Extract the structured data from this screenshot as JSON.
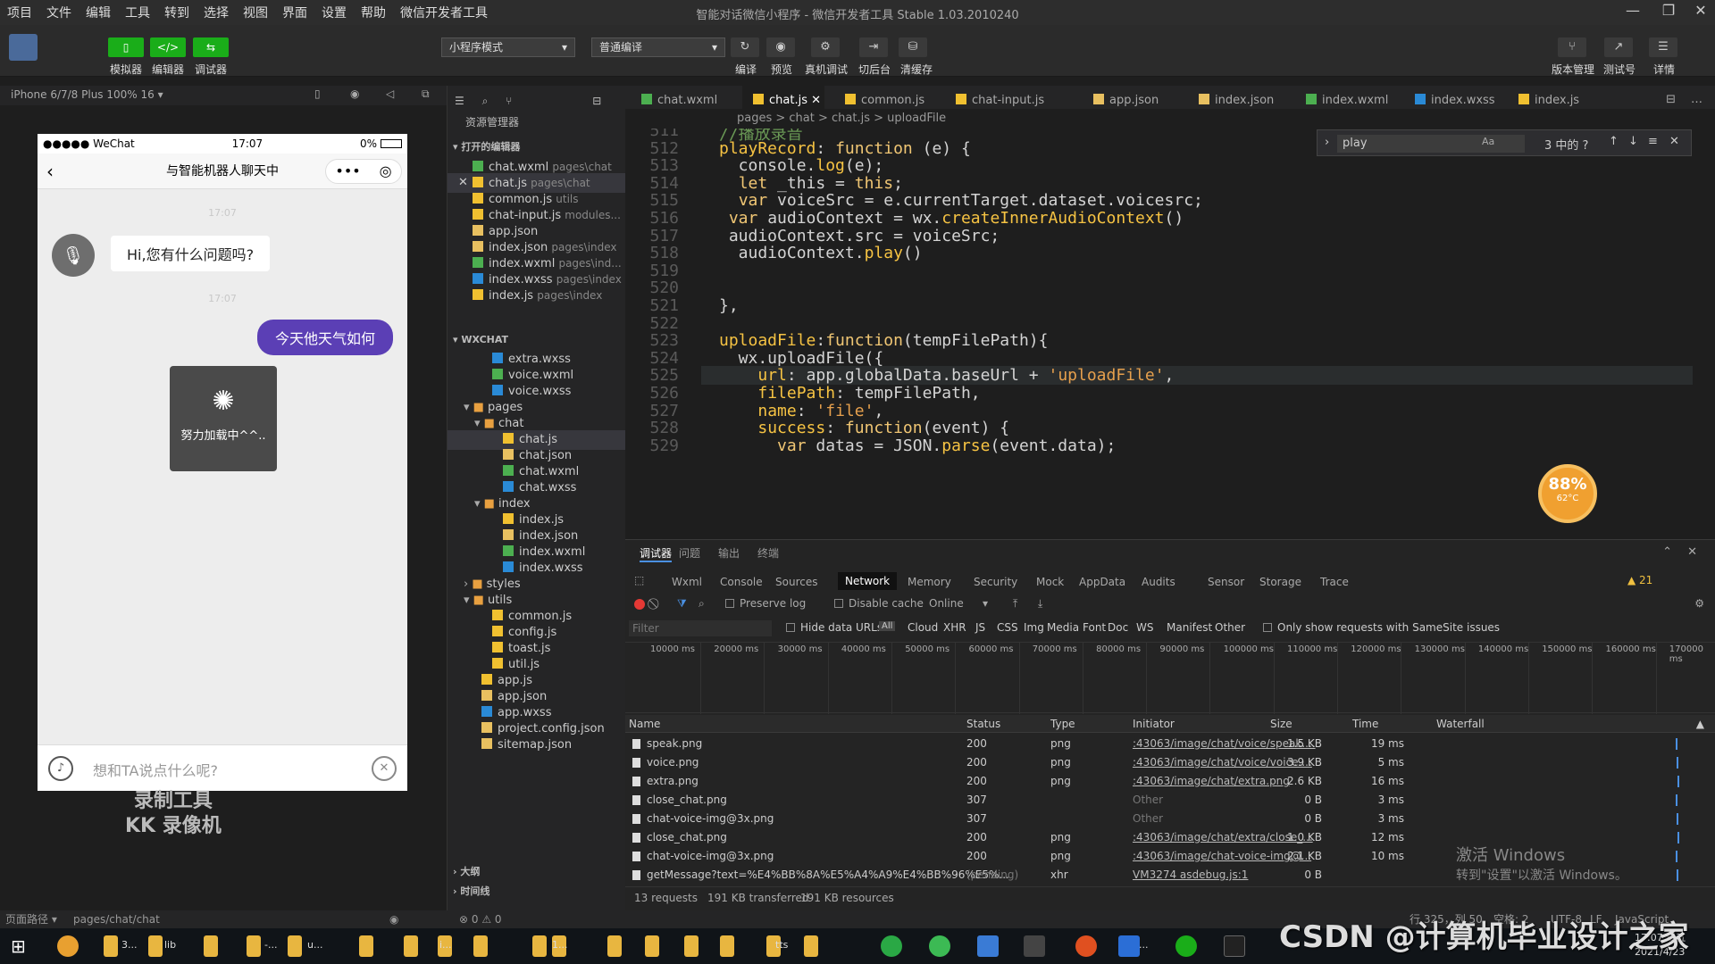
{
  "menu": [
    "项目",
    "文件",
    "编辑",
    "工具",
    "转到",
    "选择",
    "视图",
    "界面",
    "设置",
    "帮助",
    "微信开发者工具"
  ],
  "window_title": "智能对话微信小程序 - 微信开发者工具 Stable 1.03.2010240",
  "toolbar": {
    "simulator": "模拟器",
    "editor": "编辑器",
    "debugger": "调试器",
    "mode": "小程序模式",
    "compile": "普通编译",
    "compile_btn": "编译",
    "preview": "预览",
    "real_debug": "真机调试",
    "background": "切后台",
    "clear_cache": "清缓存",
    "version": "版本管理",
    "test": "测试号",
    "details": "详情"
  },
  "device": "iPhone 6/7/8 Plus 100% 16 ▾",
  "phone": {
    "carrier": "●●●●● WeChat",
    "time": "17:07",
    "battery": "0%",
    "title": "与智能机器人聊天中",
    "ts1": "17:07",
    "ts2": "17:07",
    "bot_msg": "Hi,您有什么问题吗?",
    "user_msg": "今天他天气如何",
    "loading": "努力加载中^^..",
    "input_placeholder": "想和TA说点什么呢?"
  },
  "record_watermark": [
    "录制工具",
    "KK 录像机"
  ],
  "explorer": {
    "header": "资源管理器",
    "open_editors": "打开的编辑器",
    "wxchat": "WXCHAT",
    "open_files": [
      {
        "name": "chat.wxml",
        "hint": "pages\\chat"
      },
      {
        "name": "chat.js",
        "hint": "pages\\chat"
      },
      {
        "name": "common.js",
        "hint": "utils"
      },
      {
        "name": "chat-input.js",
        "hint": "modules..."
      },
      {
        "name": "app.json",
        "hint": ""
      },
      {
        "name": "index.json",
        "hint": "pages\\index"
      },
      {
        "name": "index.wxml",
        "hint": "pages\\ind..."
      },
      {
        "name": "index.wxss",
        "hint": "pages\\index"
      },
      {
        "name": "index.js",
        "hint": "pages\\index"
      }
    ],
    "tree": [
      "extra.wxss",
      "voice.wxml",
      "voice.wxss",
      "pages",
      "chat",
      "chat.js",
      "chat.json",
      "chat.wxml",
      "chat.wxss",
      "index",
      "index.js",
      "index.json",
      "index.wxml",
      "index.wxss",
      "styles",
      "utils",
      "common.js",
      "config.js",
      "toast.js",
      "util.js",
      "app.js",
      "app.json",
      "app.wxss",
      "project.config.json",
      "sitemap.json"
    ],
    "outline": "大纲",
    "timeline": "时间线"
  },
  "tabs": [
    "chat.wxml",
    "chat.js",
    "common.js",
    "chat-input.js",
    "app.json",
    "index.json",
    "index.wxml",
    "index.wxss",
    "index.js"
  ],
  "breadcrumb": "pages > chat > chat.js > uploadFile",
  "find": {
    "query": "play",
    "count": "3 中的 ?"
  },
  "code": {
    "line_numbers": [
      "511",
      "512",
      "513",
      "514",
      "515",
      "516",
      "517",
      "518",
      "519",
      "520",
      "521",
      "522",
      "523",
      "524",
      "525",
      "526",
      "527",
      "528",
      "529"
    ],
    "lines": [
      "//播放录音",
      "playRecord: function (e) {",
      "  console.log(e);",
      "  let _this = this;",
      "  var voiceSrc = e.currentTarget.dataset.voicesrc;",
      " var audioContext = wx.createInnerAudioContext()",
      " audioContext.src = voiceSrc;",
      "  audioContext.play()",
      "",
      "",
      "},",
      "",
      "uploadFile:function(tempFilePath){",
      "  wx.uploadFile({",
      "    url: app.globalData.baseUrl + 'uploadFile',",
      "    filePath: tempFilePath,",
      "    name: 'file',",
      "    success: function(event) {",
      "      var datas = JSON.parse(event.data);"
    ]
  },
  "gauge": {
    "value": "88%",
    "temp": "62°C"
  },
  "devtools": {
    "top_tabs": [
      "调试器",
      "问题",
      "输出",
      "终端"
    ],
    "tabs": [
      "Wxml",
      "Console",
      "Sources",
      "Network",
      "Memory",
      "Security",
      "Mock",
      "AppData",
      "Audits",
      "Sensor",
      "Storage",
      "Trace"
    ],
    "warnings": "▲ 21",
    "preserve_log": "Preserve log",
    "disable_cache": "Disable cache",
    "online": "Online",
    "filter_placeholder": "Filter",
    "hide_data_urls": "Hide data URLs",
    "filters": [
      "All",
      "Cloud",
      "XHR",
      "JS",
      "CSS",
      "Img",
      "Media",
      "Font",
      "Doc",
      "WS",
      "Manifest",
      "Other"
    ],
    "samesite": "Only show requests with SameSite issues",
    "timeline": [
      "10000 ms",
      "20000 ms",
      "30000 ms",
      "40000 ms",
      "50000 ms",
      "60000 ms",
      "70000 ms",
      "80000 ms",
      "90000 ms",
      "100000 ms",
      "110000 ms",
      "120000 ms",
      "130000 ms",
      "140000 ms",
      "150000 ms",
      "160000 ms",
      "170000 ms"
    ],
    "columns": [
      "Name",
      "Status",
      "Type",
      "Initiator",
      "Size",
      "Time",
      "Waterfall"
    ],
    "rows": [
      {
        "name": "speak.png",
        "status": "200",
        "type": "png",
        "initiator": ":43063/image/chat/voice/speak....",
        "size": "1.5 KB",
        "time": "19 ms"
      },
      {
        "name": "voice.png",
        "status": "200",
        "type": "png",
        "initiator": ":43063/image/chat/voice/voice....",
        "size": "3.9 KB",
        "time": "5 ms"
      },
      {
        "name": "extra.png",
        "status": "200",
        "type": "png",
        "initiator": ":43063/image/chat/extra.png",
        "size": "2.6 KB",
        "time": "16 ms"
      },
      {
        "name": "close_chat.png",
        "status": "307",
        "type": "",
        "initiator": "Other",
        "size": "0 B",
        "time": "3 ms"
      },
      {
        "name": "chat-voice-img@3x.png",
        "status": "307",
        "type": "",
        "initiator": "Other",
        "size": "0 B",
        "time": "3 ms"
      },
      {
        "name": "close_chat.png",
        "status": "200",
        "type": "png",
        "initiator": ":43063/image/chat/extra/close_...",
        "size": "1.0 KB",
        "time": "12 ms"
      },
      {
        "name": "chat-voice-img@3x.png",
        "status": "200",
        "type": "png",
        "initiator": ":43063/image/chat-voice-img@...",
        "size": "2.1 KB",
        "time": "10 ms"
      },
      {
        "name": "getMessage?text=%E4%BB%8A%E5%A4%A9%E4%BB%96%E5%...",
        "status": "(pending)",
        "type": "xhr",
        "initiator": "VM3274 asdebug.js:1",
        "size": "0 B",
        "time": ""
      }
    ],
    "summary": [
      "13 requests",
      "191 KB transferred",
      "191 KB resources"
    ]
  },
  "activate_windows": [
    "激活 Windows",
    "转到\"设置\"以激活 Windows。"
  ],
  "statusbar": {
    "path_label": "页面路径 ▾",
    "path": "pages/chat/chat",
    "errors": "⊗ 0 ⚠ 0",
    "position": "行 325，列 50",
    "spaces": "空格: 2",
    "encoding": "UTF-8",
    "eol": "LF",
    "lang": "JavaScript"
  },
  "taskbar": {
    "labels": [
      "3...",
      "lib",
      "-...",
      "u...",
      "i...",
      "1...",
      "tts",
      "5..."
    ],
    "time": "17:07 周五",
    "date": "2021/4/23"
  },
  "csdn_watermark": "CSDN @计算机毕业设计之家"
}
